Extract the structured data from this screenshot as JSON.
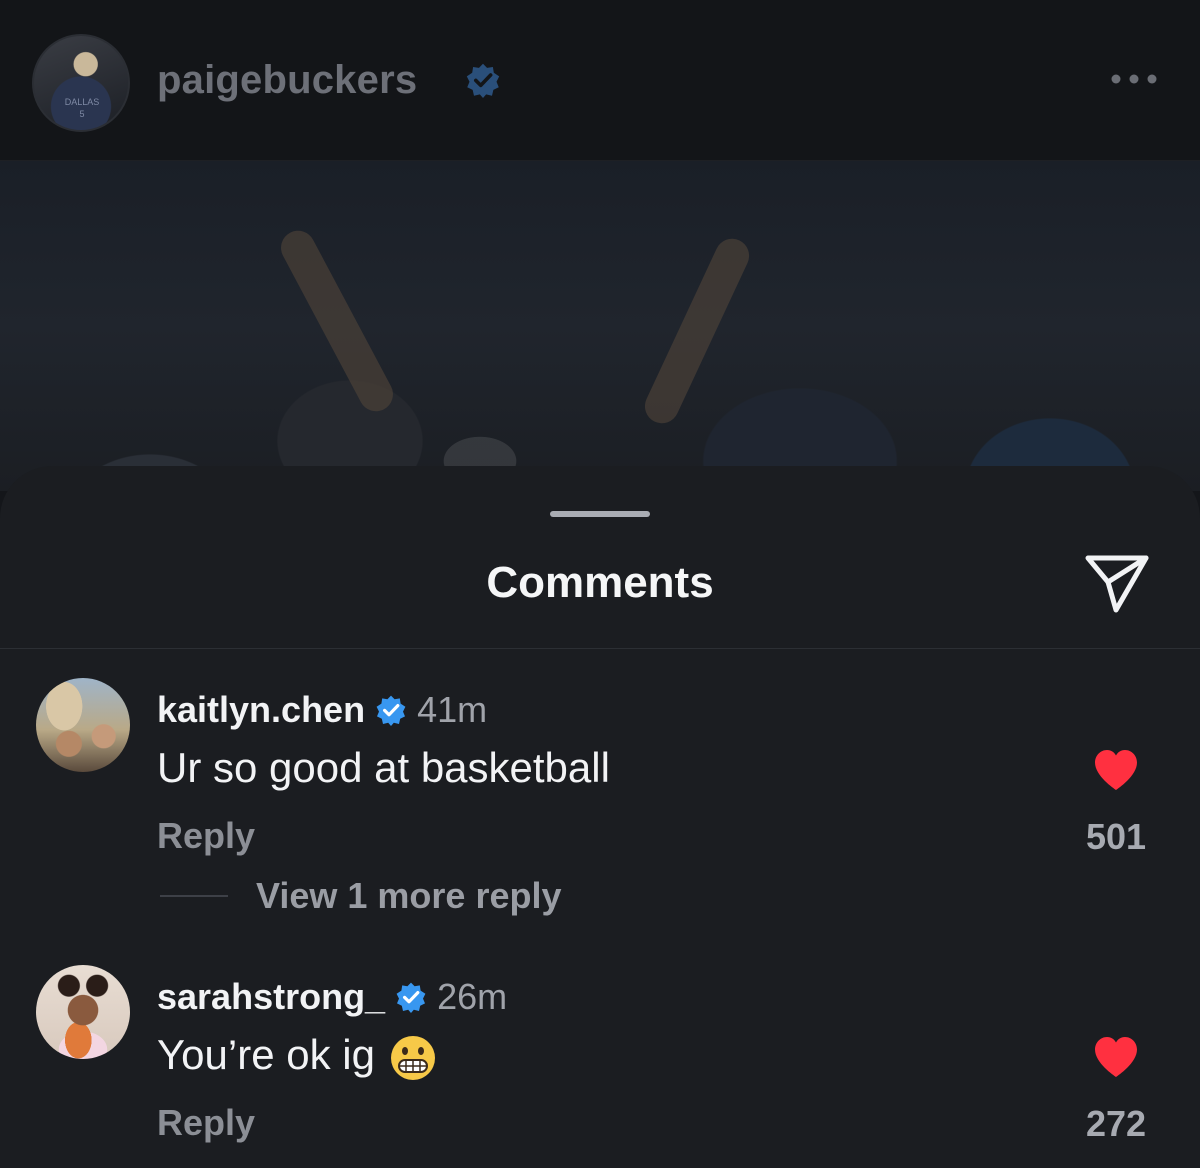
{
  "post": {
    "author": "paigebuckers",
    "avatar_jersey_text": "DALLAS 5"
  },
  "sheet": {
    "title": "Comments"
  },
  "comments": [
    {
      "user": "kaitlyn.chen",
      "time": "41m",
      "text": "Ur so good at basketball",
      "reply_label": "Reply",
      "likes": "501",
      "liked": true
    },
    {
      "user": "sarahstrong_",
      "time": "26m",
      "text": "You’re ok ig",
      "emoji": "grimacing-face",
      "reply_label": "Reply",
      "likes": "272",
      "liked": true
    }
  ],
  "view_replies": "View 1 more reply",
  "colors": {
    "background": "#1b1d21",
    "verified_blue": "#3897f0",
    "heart_red": "#ff3040",
    "muted_text": "#a0a3aa"
  },
  "icons": [
    "verified-badge-icon",
    "more-options-icon",
    "share-send-icon",
    "heart-icon"
  ]
}
